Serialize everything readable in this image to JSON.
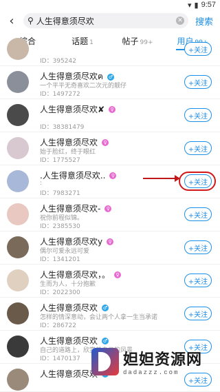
{
  "status": {
    "time": "9:57"
  },
  "search": {
    "query": "人生得意须尽欢",
    "button": "搜索"
  },
  "tabs": [
    {
      "label": "综合",
      "count": ""
    },
    {
      "label": "话题",
      "count": "1"
    },
    {
      "label": "帖子",
      "count": "99+"
    },
    {
      "label": "用户",
      "count": "99+"
    }
  ],
  "users": [
    {
      "name": "",
      "signature": "",
      "id": "ID：395242",
      "gender": "f"
    },
    {
      "name": "人生得意须尽欢ฅ",
      "signature": "一个平平无奇喜欢二次元的靓仔",
      "id": "ID：1497272",
      "gender": "m"
    },
    {
      "name": "人生得意须尽欢✘",
      "signature": "",
      "id": "ID：38381479",
      "gender": "f"
    },
    {
      "name": "人生得意须尽欢",
      "signature": "始于脸红，终于眼红",
      "id": "ID：1775527",
      "gender": "f"
    },
    {
      "name": ".人生得意须尽欢..",
      "signature": ":",
      "id": "ID：7983271",
      "gender": "f"
    },
    {
      "name": "人生得意须尽欢-",
      "signature": "祝你前程似锦。",
      "id": "ID：2385530",
      "gender": "f"
    },
    {
      "name": "人生得意须尽欢y",
      "signature": "偶尔可爱永远可爱",
      "id": "ID：1341201",
      "gender": "f"
    },
    {
      "name": "人生得意须尽欢，。",
      "signature": "生而为人，十分抱歉",
      "id": "ID：2022300",
      "gender": "f"
    },
    {
      "name": "人生得意须尽欢",
      "signature": "怎样的情深意动，会让两个人拿一生当承诺",
      "id": "ID：286722",
      "gender": "m"
    },
    {
      "name": "人生得意须尽欢",
      "signature": "自己的道路上，欣赏着自己的风景",
      "id": "ID：1470137",
      "gender": "m"
    },
    {
      "name": "人生得意须尽欢",
      "signature": "",
      "id": "",
      "gender": "m"
    }
  ],
  "follow_label": "+关注",
  "avatar_colors": [
    "#c9b8a8",
    "#8a8f9a",
    "#4a4a4a",
    "#d8c8d0",
    "#a8b8d8",
    "#e8c8c0",
    "#7a6a5a",
    "#e0d0c0",
    "#6a5a4a",
    "#3a3a3a",
    "#9a8a7a"
  ],
  "accent": "#1e8fe6",
  "watermark": {
    "title": "妲妲资源网",
    "url": "dadazzz.com"
  }
}
